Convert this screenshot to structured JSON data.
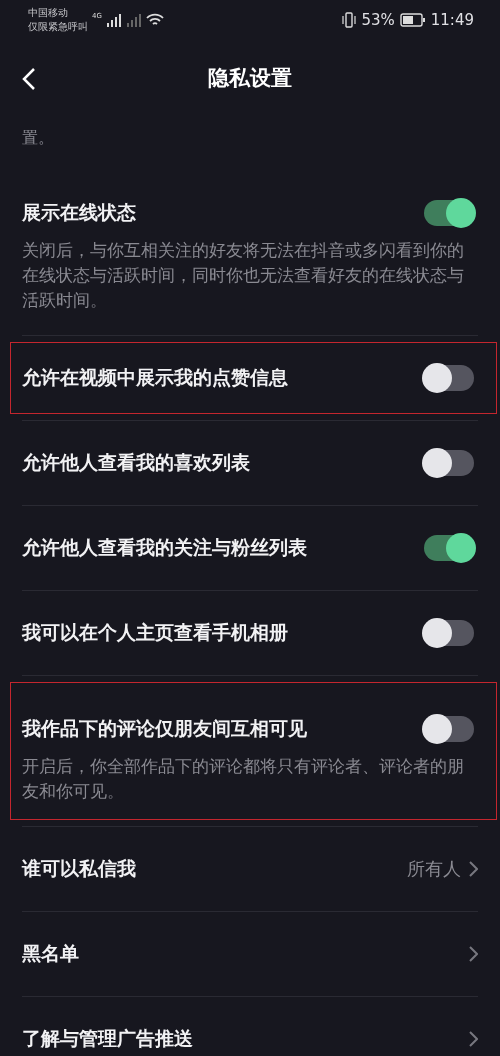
{
  "status_bar": {
    "carrier": "中国移动",
    "carrier_note": "仅限紧急呼叫",
    "network": "4G",
    "battery": "53%",
    "time": "11:49"
  },
  "header": {
    "title": "隐私设置"
  },
  "clipped_text": "置。",
  "settings": [
    {
      "kind": "toggle",
      "title": "展示在线状态",
      "description": "关闭后，与你互相关注的好友将无法在抖音或多闪看到你的在线状态与活跃时间，同时你也无法查看好友的在线状态与活跃时间。",
      "on": true,
      "highlighted": false
    },
    {
      "kind": "toggle",
      "title": "允许在视频中展示我的点赞信息",
      "on": false,
      "highlighted": true
    },
    {
      "kind": "toggle",
      "title": "允许他人查看我的喜欢列表",
      "on": false,
      "highlighted": false
    },
    {
      "kind": "toggle",
      "title": "允许他人查看我的关注与粉丝列表",
      "on": true,
      "highlighted": false
    },
    {
      "kind": "toggle",
      "title": "我可以在个人主页查看手机相册",
      "on": false,
      "highlighted": false
    },
    {
      "kind": "toggle",
      "title": "我作品下的评论仅朋友间互相可见",
      "description": "开启后，你全部作品下的评论都将只有评论者、评论者的朋友和你可见。",
      "on": false,
      "highlighted": true
    },
    {
      "kind": "link",
      "title": "谁可以私信我",
      "value": "所有人",
      "highlighted": false
    },
    {
      "kind": "link",
      "title": "黑名单",
      "highlighted": false
    },
    {
      "kind": "link",
      "title": "了解与管理广告推送",
      "highlighted": false
    }
  ]
}
